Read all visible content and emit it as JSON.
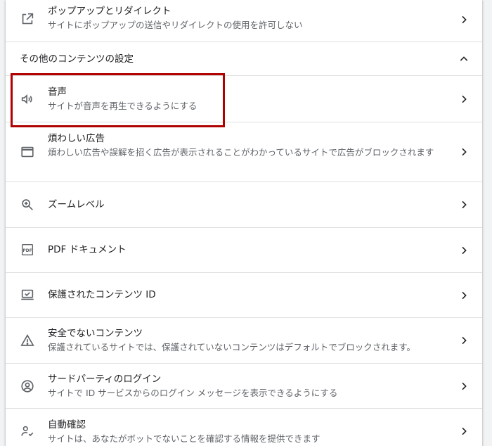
{
  "rows": {
    "popups": {
      "title": "ポップアップとリダイレクト",
      "desc": "サイトにポップアップの送信やリダイレクトの使用を許可しない",
      "icon": "external-link-icon"
    },
    "sound": {
      "title": "音声",
      "desc": "サイトが音声を再生できるようにする",
      "icon": "volume-icon"
    },
    "ads": {
      "title": "煩わしい広告",
      "desc": "煩わしい広告や誤解を招く広告が表示されることがわかっているサイトで広告がブロックされます",
      "icon": "window-icon"
    },
    "zoom": {
      "title": "ズームレベル",
      "icon": "zoom-icon"
    },
    "pdf": {
      "title": "PDF ドキュメント",
      "icon": "pdf-icon"
    },
    "protected": {
      "title": "保護されたコンテンツ ID",
      "icon": "protected-content-icon"
    },
    "insecure": {
      "title": "安全でないコンテンツ",
      "desc": "保護されているサイトでは、保護されていないコンテンツはデフォルトでブロックされます。",
      "icon": "warning-icon"
    },
    "thirdparty": {
      "title": "サードパーティのログイン",
      "desc": "サイトで ID サービスからのログイン メッセージを表示できるようにする",
      "icon": "account-circle-icon"
    },
    "autoverify": {
      "title": "自動確認",
      "desc": "サイトは、あなたがボットでないことを確認する情報を提供できます",
      "icon": "person-check-icon"
    }
  },
  "section": {
    "label": "その他のコンテンツの設定"
  },
  "colors": {
    "highlight": "#b00000",
    "icon": "#5f6368",
    "text": "#202124",
    "secondary": "#5f6368"
  }
}
